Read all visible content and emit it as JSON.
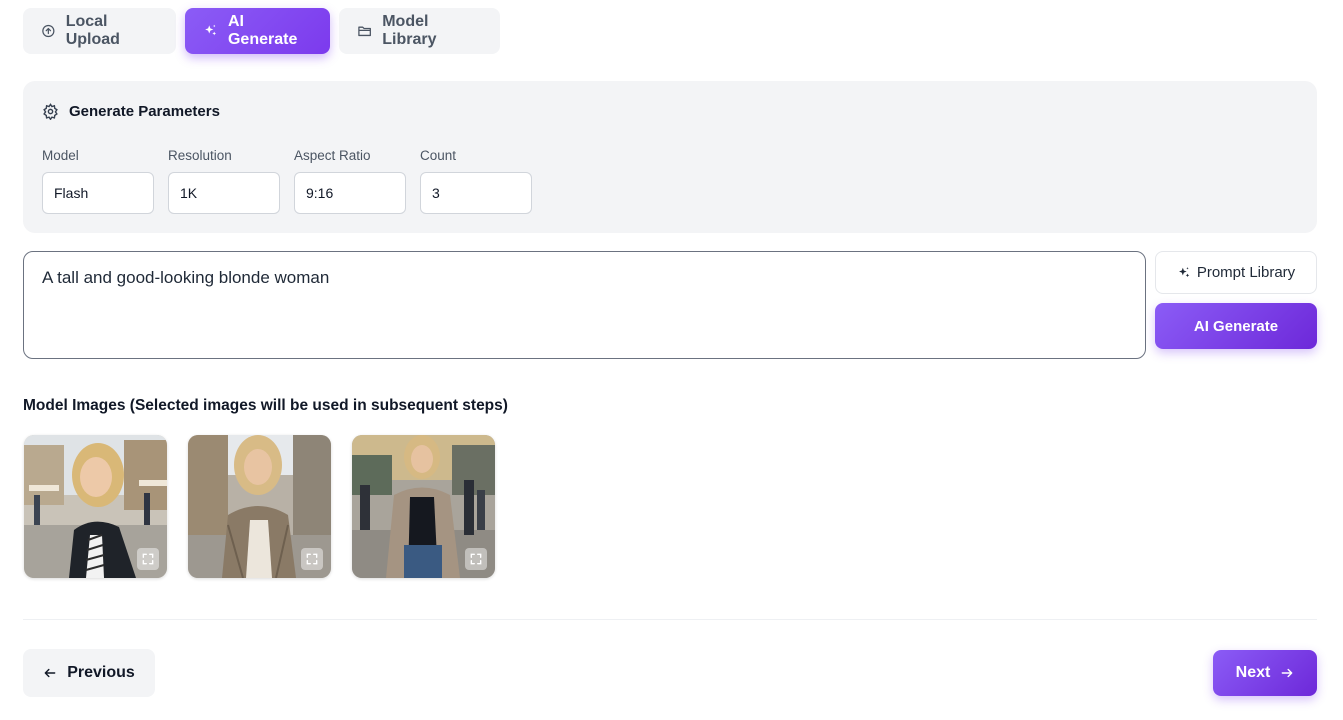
{
  "tabs": [
    {
      "label": "Local Upload",
      "icon": "upload-cloud-icon",
      "active": false
    },
    {
      "label": "AI Generate",
      "icon": "sparkles-icon",
      "active": true
    },
    {
      "label": "Model Library",
      "icon": "folder-icon",
      "active": false
    }
  ],
  "params": {
    "title": "Generate Parameters",
    "icon": "gear-icon",
    "fields": [
      {
        "label": "Model",
        "value": "Flash"
      },
      {
        "label": "Resolution",
        "value": "1K"
      },
      {
        "label": "Aspect Ratio",
        "value": "9:16"
      },
      {
        "label": "Count",
        "value": "3"
      }
    ]
  },
  "prompt": {
    "value": "A tall and good-looking blonde woman",
    "library_label": "Prompt Library",
    "generate_label": "AI Generate"
  },
  "images": {
    "title": "Model Images (Selected images will be used in subsequent steps)",
    "items": [
      {
        "name": "model-image-1",
        "icon": "expand-icon"
      },
      {
        "name": "model-image-2",
        "icon": "expand-icon"
      },
      {
        "name": "model-image-3",
        "icon": "expand-icon"
      }
    ]
  },
  "footer": {
    "previous_label": "Previous",
    "next_label": "Next"
  },
  "colors": {
    "accent": "#7c3aed",
    "panel": "#f3f4f6"
  }
}
